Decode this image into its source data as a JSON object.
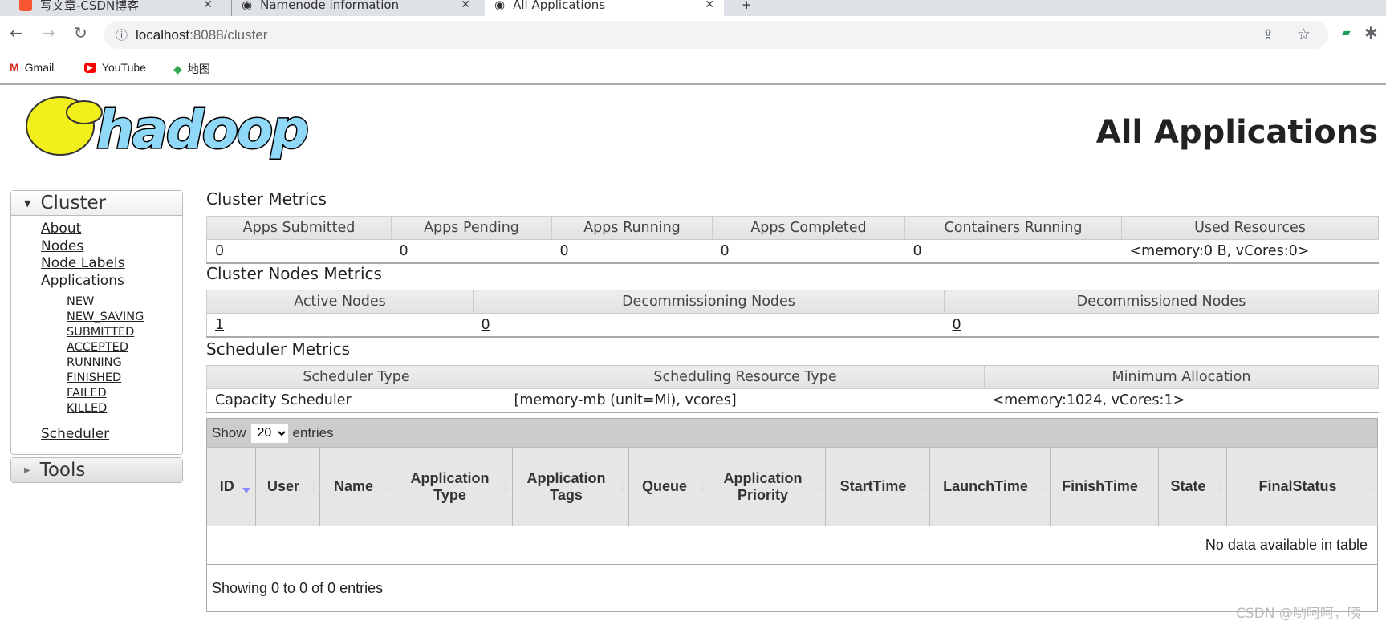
{
  "browser": {
    "tabs": [
      {
        "label": "写文章-CSDN博客",
        "active": false
      },
      {
        "label": "Namenode information",
        "active": false
      },
      {
        "label": "All Applications",
        "active": true
      }
    ],
    "url_host": "localhost",
    "url_rest": ":8088/cluster",
    "bookmarks": [
      "Gmail",
      "YouTube",
      "地图"
    ]
  },
  "page": {
    "title": "All Applications",
    "logo_text": "hadoop"
  },
  "sidebar": {
    "cluster_label": "Cluster",
    "links": [
      "About",
      "Nodes",
      "Node Labels",
      "Applications"
    ],
    "app_states": [
      "NEW",
      "NEW_SAVING",
      "SUBMITTED",
      "ACCEPTED",
      "RUNNING",
      "FINISHED",
      "FAILED",
      "KILLED"
    ],
    "scheduler": "Scheduler",
    "tools_label": "Tools"
  },
  "cluster_metrics": {
    "heading": "Cluster Metrics",
    "headers": [
      "Apps Submitted",
      "Apps Pending",
      "Apps Running",
      "Apps Completed",
      "Containers Running",
      "Used Resources"
    ],
    "values": [
      "0",
      "0",
      "0",
      "0",
      "0",
      "<memory:0 B, vCores:0>"
    ]
  },
  "nodes_metrics": {
    "heading": "Cluster Nodes Metrics",
    "headers": [
      "Active Nodes",
      "Decommissioning Nodes",
      "Decommissioned Nodes"
    ],
    "values": [
      "1",
      "0",
      "0"
    ]
  },
  "scheduler_metrics": {
    "heading": "Scheduler Metrics",
    "headers": [
      "Scheduler Type",
      "Scheduling Resource Type",
      "Minimum Allocation"
    ],
    "values": [
      "Capacity Scheduler",
      "[memory-mb (unit=Mi), vcores]",
      "<memory:1024, vCores:1>"
    ]
  },
  "apps_table": {
    "show": "Show",
    "page_size": "20",
    "entries": "entries",
    "columns": [
      "ID",
      "User",
      "Name",
      "Application Type",
      "Application Tags",
      "Queue",
      "Application Priority",
      "StartTime",
      "LaunchTime",
      "FinishTime",
      "State",
      "FinalStatus"
    ],
    "empty": "No data available in table",
    "footer": "Showing 0 to 0 of 0 entries"
  },
  "watermark": "CSDN @哟呵呵，咦",
  "colors": {
    "logo_blue": "#8fd8f8",
    "logo_yellow": "#f2f01a",
    "sort_active": "#8888ff"
  }
}
